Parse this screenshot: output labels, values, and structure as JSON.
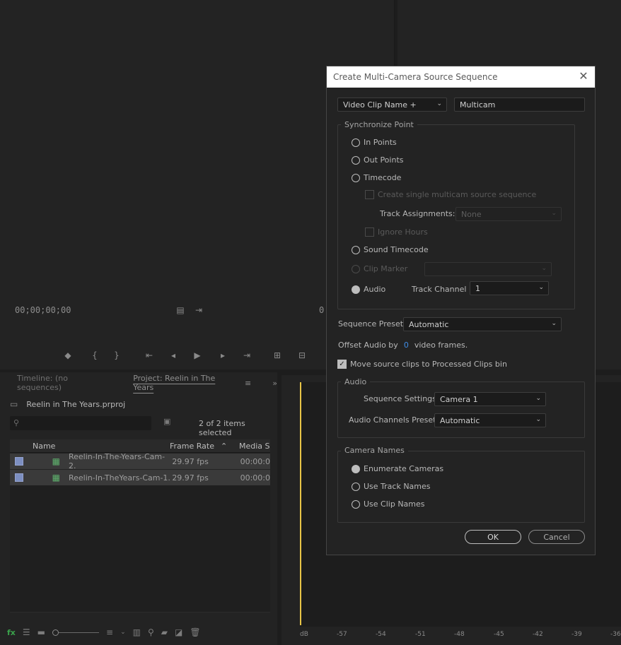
{
  "source_monitor": {
    "timecode": "00;00;00;00",
    "program_timecode_fragment": "0"
  },
  "project_panel": {
    "tabs": [
      "Timeline: (no sequences)",
      "Project: Reelin in The Years"
    ],
    "project_file": "Reelin in The Years.prproj",
    "selection_status": "2 of 2 items selected",
    "columns": [
      "Name",
      "Frame Rate",
      "Media S"
    ],
    "rows": [
      {
        "name": "Reelin-In-The-Years-Cam-2.",
        "frame_rate": "29.97 fps",
        "media": "00:00:0"
      },
      {
        "name": "Reelin-In-TheYears-Cam-1.",
        "frame_rate": "29.97 fps",
        "media": "00:00:0"
      }
    ]
  },
  "audio_meter": {
    "scale": [
      "dB",
      "-57",
      "-54",
      "-51",
      "-48",
      "-45",
      "-42",
      "-39",
      "-36"
    ],
    "playhead_color": "#e8c547"
  },
  "dialog": {
    "title": "Create Multi-Camera Source Sequence",
    "naming_dropdown": "Video Clip Name +",
    "name_field": "Multicam",
    "sync_legend": "Synchronize Point",
    "sync_options": {
      "in_points": "In Points",
      "out_points": "Out Points",
      "timecode": "Timecode",
      "single_multicam": "Create single multicam source sequence",
      "track_assignments_label": "Track Assignments:",
      "track_assignments_value": "None",
      "ignore_hours": "Ignore Hours",
      "sound_timecode": "Sound Timecode",
      "clip_marker": "Clip Marker",
      "audio": "Audio",
      "track_channel_label": "Track Channel",
      "track_channel_value": "1"
    },
    "sequence_preset_label": "Sequence Preset:",
    "sequence_preset_value": "Automatic",
    "offset_prefix": "Offset Audio by",
    "offset_value": "0",
    "offset_suffix": "video frames.",
    "move_clips_label": "Move source clips to Processed Clips bin",
    "audio_legend": "Audio",
    "sequence_settings_label": "Sequence Settings:",
    "sequence_settings_value": "Camera 1",
    "audio_channels_label": "Audio Channels Preset:",
    "audio_channels_value": "Automatic",
    "camera_names_legend": "Camera Names",
    "camera_names": {
      "enumerate": "Enumerate Cameras",
      "track": "Use Track Names",
      "clip": "Use Clip Names"
    },
    "ok_label": "OK",
    "cancel_label": "Cancel"
  },
  "colors": {
    "accent_blue": "#3f8ce5",
    "clip_swatch": "#7d8fc1",
    "fx_green": "#3aa14b"
  }
}
